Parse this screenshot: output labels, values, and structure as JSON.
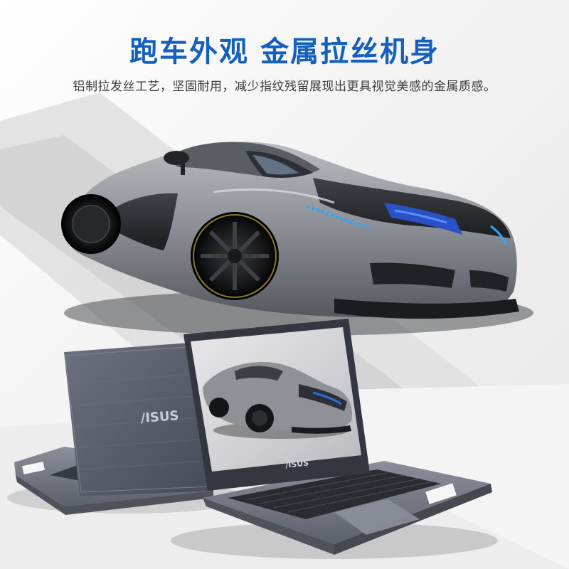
{
  "headline": "跑车外观 金属拉丝机身",
  "subline": "铝制拉发丝工艺，坚固耐用，减少指纹残留展现出更具视觉美感的金属质感。",
  "brand": {
    "rear_logo": "/ISUS",
    "bezel_logo": "/ISUS"
  },
  "colors": {
    "accent": "#1560bd",
    "metal": "#7a7d85",
    "lid": "#5c6070",
    "car_body": "#8e9196"
  },
  "icons": [
    "sports-car-image",
    "laptop-rear-image",
    "laptop-front-image"
  ]
}
